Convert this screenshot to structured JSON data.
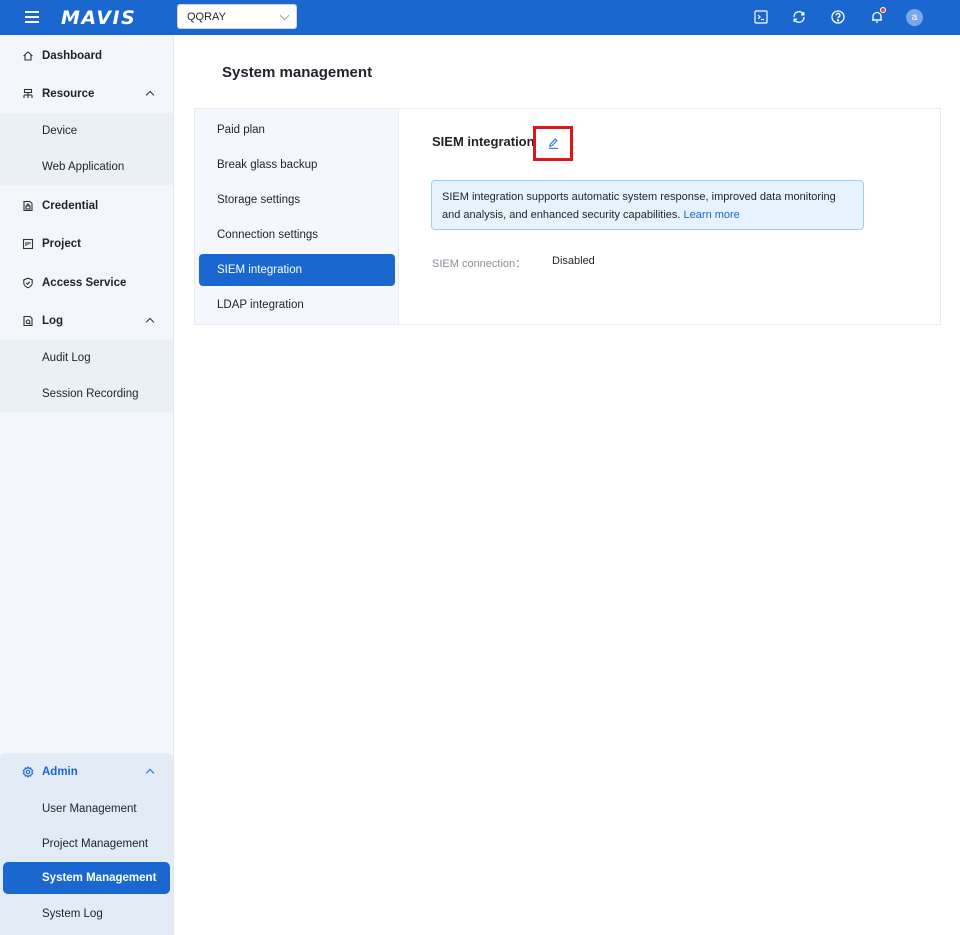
{
  "header": {
    "logo": "MAVIS",
    "tenant": "QQRAY",
    "avatar_letter": "a",
    "icons": [
      "terminal-icon",
      "refresh-icon",
      "help-icon",
      "bell-icon"
    ]
  },
  "sidebar": {
    "items": [
      {
        "label": "Dashboard"
      },
      {
        "label": "Resource"
      },
      {
        "label": "Device"
      },
      {
        "label": "Web Application"
      },
      {
        "label": "Credential"
      },
      {
        "label": "Project"
      },
      {
        "label": "Access Service"
      },
      {
        "label": "Log"
      },
      {
        "label": "Audit Log"
      },
      {
        "label": "Session Recording"
      }
    ],
    "admin": {
      "label": "Admin",
      "items": [
        {
          "label": "User Management"
        },
        {
          "label": "Project Management"
        },
        {
          "label": "System Management"
        },
        {
          "label": "System Log"
        }
      ]
    }
  },
  "main": {
    "title": "System management",
    "tabs": [
      {
        "label": "Paid plan"
      },
      {
        "label": "Break glass backup"
      },
      {
        "label": "Storage settings"
      },
      {
        "label": "Connection settings"
      },
      {
        "label": "SIEM integration"
      },
      {
        "label": "LDAP integration"
      }
    ],
    "section_title": "SIEM integration",
    "info_text": "SIEM integration supports automatic system response, improved data monitoring and analysis, and enhanced security capabilities.",
    "info_link": "Learn more",
    "field_label": "SIEM connection：",
    "field_value": "Disabled"
  },
  "colors": {
    "primary": "#1a67cf",
    "highlight_border": "#e0151b"
  }
}
